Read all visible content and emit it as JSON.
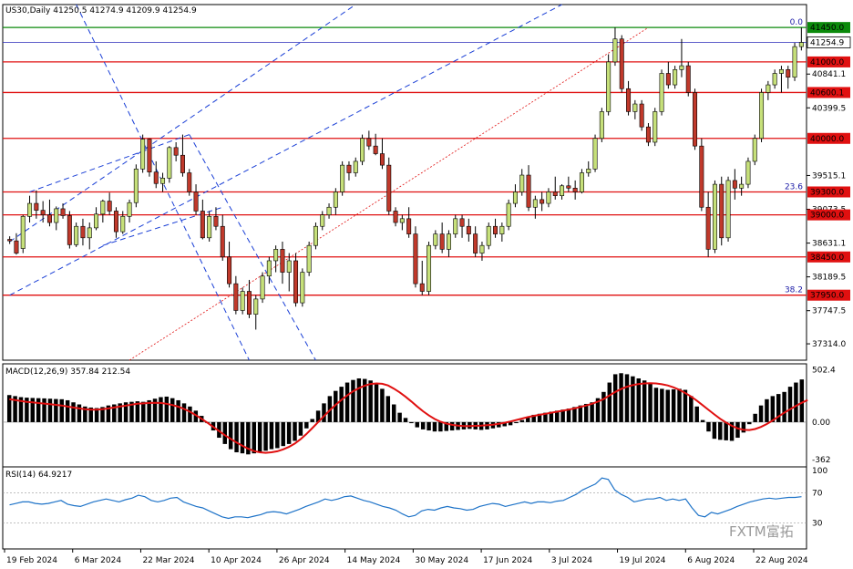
{
  "header": {
    "symbol_line": "US30,Daily  41250.5 41274.9 41209.9 41254.9",
    "macd_label": "MACD(12,26,9) 357.84 212.54",
    "rsi_label": "RSI(14) 64.9217"
  },
  "watermark": "FXTM富拓",
  "colors": {
    "bull": "#c6e07a",
    "bear": "#c0392b",
    "level": "#e01010",
    "channel": "#1a3fd6",
    "fib_line": "#0b8a0b",
    "rsi": "#1e73c8",
    "macd_signal": "#e01010",
    "grid": "#808080"
  },
  "chart_data": [
    {
      "type": "candlestick",
      "title": "US30,Daily",
      "ylim": [
        37100,
        41750
      ],
      "y_ticks": [
        41254.9,
        40841.1,
        40399.5,
        39515.1,
        39073.5,
        38631.1,
        38189.5,
        37747.5,
        37314.0
      ],
      "x_labels": [
        "19 Feb 2024",
        "6 Mar 2024",
        "22 Mar 2024",
        "10 Apr 2024",
        "26 Apr 2024",
        "14 May 2024",
        "30 May 2024",
        "17 Jun 2024",
        "3 Jul 2024",
        "19 Jul 2024",
        "6 Aug 2024",
        "22 Aug 2024"
      ],
      "horizontal_levels": [
        41450.0,
        41000.0,
        40600.1,
        40000.0,
        39300.0,
        39000.0,
        38450.0,
        37950.0
      ],
      "current_price": 41254.9,
      "fib_levels": [
        {
          "label": "0.0",
          "value": 41450.0
        },
        {
          "label": "23.6",
          "value": 39300.0
        },
        {
          "label": "38.2",
          "value": 37950.0
        }
      ],
      "candles": [
        [
          38680,
          38720,
          38620,
          38660
        ],
        [
          38660,
          38760,
          38480,
          38500
        ],
        [
          38560,
          39000,
          38500,
          38980
        ],
        [
          38980,
          39250,
          38900,
          39150
        ],
        [
          39150,
          39320,
          38950,
          39060
        ],
        [
          39060,
          39180,
          38900,
          39000
        ],
        [
          39000,
          39200,
          38850,
          38900
        ],
        [
          38900,
          39110,
          38800,
          39080
        ],
        [
          39080,
          39150,
          38950,
          38990
        ],
        [
          38990,
          39050,
          38560,
          38610
        ],
        [
          38610,
          38900,
          38580,
          38850
        ],
        [
          38850,
          38950,
          38600,
          38700
        ],
        [
          38700,
          38900,
          38550,
          38830
        ],
        [
          38830,
          39100,
          38800,
          39010
        ],
        [
          39010,
          39200,
          38900,
          39180
        ],
        [
          39180,
          39290,
          39000,
          39050
        ],
        [
          39050,
          39100,
          38700,
          38780
        ],
        [
          38780,
          39050,
          38750,
          38980
        ],
        [
          38980,
          39200,
          38900,
          39160
        ],
        [
          39160,
          39660,
          39100,
          39600
        ],
        [
          39600,
          40050,
          39550,
          39990
        ],
        [
          39990,
          40000,
          39500,
          39560
        ],
        [
          39560,
          39700,
          39350,
          39410
        ],
        [
          39410,
          39550,
          39300,
          39480
        ],
        [
          39480,
          39900,
          39420,
          39880
        ],
        [
          39880,
          39950,
          39700,
          39780
        ],
        [
          39780,
          40050,
          39500,
          39550
        ],
        [
          39550,
          39600,
          39250,
          39300
        ],
        [
          39300,
          39400,
          39000,
          39050
        ],
        [
          39050,
          39200,
          38680,
          38700
        ],
        [
          38700,
          39050,
          38650,
          38980
        ],
        [
          38980,
          39100,
          38800,
          38850
        ],
        [
          38850,
          39000,
          38400,
          38450
        ],
        [
          38450,
          38650,
          38050,
          38100
        ],
        [
          38100,
          38200,
          37700,
          37750
        ],
        [
          37750,
          38050,
          37700,
          38000
        ],
        [
          38000,
          38150,
          37650,
          37700
        ],
        [
          37700,
          37950,
          37500,
          37900
        ],
        [
          37900,
          38250,
          37850,
          38200
        ],
        [
          38200,
          38450,
          38100,
          38400
        ],
        [
          38400,
          38600,
          38250,
          38550
        ],
        [
          38550,
          38650,
          38100,
          38250
        ],
        [
          38250,
          38500,
          38000,
          38400
        ],
        [
          38400,
          38500,
          37800,
          37850
        ],
        [
          37850,
          38300,
          37800,
          38250
        ],
        [
          38250,
          38650,
          38200,
          38600
        ],
        [
          38600,
          38900,
          38550,
          38850
        ],
        [
          38850,
          39050,
          38800,
          39000
        ],
        [
          39000,
          39150,
          38950,
          39100
        ],
        [
          39100,
          39350,
          39000,
          39300
        ],
        [
          39300,
          39700,
          39250,
          39650
        ],
        [
          39650,
          39700,
          39450,
          39550
        ],
        [
          39550,
          39750,
          39500,
          39700
        ],
        [
          39700,
          40050,
          39650,
          40000
        ],
        [
          40000,
          40100,
          39850,
          39900
        ],
        [
          39900,
          40060,
          39780,
          39800
        ],
        [
          39800,
          40000,
          39600,
          39650
        ],
        [
          39650,
          39750,
          39000,
          39050
        ],
        [
          39050,
          39100,
          38850,
          38900
        ],
        [
          38900,
          39000,
          38800,
          38950
        ],
        [
          38950,
          39100,
          38700,
          38750
        ],
        [
          38750,
          38850,
          38050,
          38100
        ],
        [
          38100,
          38400,
          37950,
          38000
        ],
        [
          38000,
          38650,
          37950,
          38600
        ],
        [
          38600,
          38800,
          38550,
          38750
        ],
        [
          38750,
          38900,
          38500,
          38550
        ],
        [
          38550,
          38800,
          38450,
          38750
        ],
        [
          38750,
          39000,
          38700,
          38950
        ],
        [
          38950,
          39000,
          38700,
          38850
        ],
        [
          38850,
          38950,
          38650,
          38750
        ],
        [
          38750,
          38850,
          38450,
          38500
        ],
        [
          38500,
          38650,
          38400,
          38600
        ],
        [
          38600,
          38900,
          38550,
          38850
        ],
        [
          38850,
          38950,
          38700,
          38750
        ],
        [
          38750,
          38900,
          38650,
          38850
        ],
        [
          38850,
          39200,
          38800,
          39150
        ],
        [
          39150,
          39400,
          39100,
          39300
        ],
        [
          39300,
          39600,
          39250,
          39520
        ],
        [
          39520,
          39650,
          39050,
          39100
        ],
        [
          39100,
          39250,
          38950,
          39200
        ],
        [
          39200,
          39300,
          39050,
          39150
        ],
        [
          39150,
          39350,
          39100,
          39300
        ],
        [
          39300,
          39500,
          39200,
          39250
        ],
        [
          39250,
          39400,
          39200,
          39380
        ],
        [
          39380,
          39500,
          39300,
          39350
        ],
        [
          39350,
          39450,
          39200,
          39300
        ],
        [
          39300,
          39600,
          39280,
          39550
        ],
        [
          39550,
          39700,
          39500,
          39600
        ],
        [
          39600,
          40050,
          39560,
          40000
        ],
        [
          40000,
          40400,
          39950,
          40350
        ],
        [
          40350,
          41100,
          40300,
          41000
        ],
        [
          41000,
          41450,
          40950,
          41300
        ],
        [
          41300,
          41350,
          40600,
          40650
        ],
        [
          40650,
          40750,
          40300,
          40350
        ],
        [
          40350,
          40500,
          40250,
          40450
        ],
        [
          40450,
          40500,
          40100,
          40150
        ],
        [
          40150,
          40200,
          39900,
          39950
        ],
        [
          39950,
          40400,
          39900,
          40350
        ],
        [
          40350,
          40900,
          40300,
          40850
        ],
        [
          40850,
          41000,
          40650,
          40700
        ],
        [
          40700,
          40950,
          40650,
          40900
        ],
        [
          40900,
          41300,
          40800,
          40950
        ],
        [
          40950,
          41000,
          40550,
          40600
        ],
        [
          40600,
          40650,
          39850,
          39900
        ],
        [
          39900,
          40000,
          39050,
          39100
        ],
        [
          39100,
          39300,
          38450,
          38550
        ],
        [
          38550,
          39450,
          38500,
          39400
        ],
        [
          39400,
          39500,
          38600,
          38700
        ],
        [
          38700,
          39500,
          38650,
          39450
        ],
        [
          39450,
          39600,
          39200,
          39350
        ],
        [
          39350,
          39500,
          39250,
          39400
        ],
        [
          39400,
          39750,
          39350,
          39700
        ],
        [
          39700,
          40050,
          39650,
          40000
        ],
        [
          40000,
          40650,
          39950,
          40600
        ],
        [
          40600,
          40750,
          40500,
          40700
        ],
        [
          40700,
          40900,
          40650,
          40850
        ],
        [
          40850,
          40950,
          40600,
          40900
        ],
        [
          40900,
          40950,
          40650,
          40800
        ],
        [
          40800,
          41250,
          40750,
          41200
        ],
        [
          41200,
          41450,
          41150,
          41255
        ]
      ]
    },
    {
      "type": "bar",
      "title": "MACD(12,26,9) 357.84 212.54",
      "ylim": [
        -430,
        560
      ],
      "y_ticks": [
        502.4,
        0.0,
        -362
      ],
      "series": [
        {
          "name": "MACD",
          "values": [
            260,
            250,
            240,
            235,
            232,
            230,
            228,
            225,
            222,
            220,
            210,
            190,
            170,
            150,
            140,
            135,
            145,
            160,
            170,
            180,
            190,
            195,
            200,
            195,
            210,
            225,
            240,
            245,
            230,
            210,
            180,
            150,
            110,
            60,
            -10,
            -80,
            -150,
            -210,
            -260,
            -290,
            -300,
            -310,
            -300,
            -290,
            -275,
            -260,
            -250,
            -230,
            -210,
            -180,
            -130,
            -60,
            30,
            110,
            180,
            250,
            300,
            340,
            380,
            405,
            420,
            415,
            400,
            370,
            320,
            250,
            170,
            90,
            40,
            -10,
            -50,
            -70,
            -80,
            -90,
            -90,
            -85,
            -80,
            -75,
            -70,
            -65,
            -70,
            -75,
            -70,
            -60,
            -50,
            -40,
            -30,
            -10,
            20,
            50,
            70,
            80,
            90,
            100,
            110,
            120,
            130,
            145,
            160,
            175,
            190,
            230,
            290,
            380,
            460,
            470,
            460,
            440,
            420,
            400,
            370,
            330,
            320,
            310,
            315,
            320,
            310,
            250,
            150,
            20,
            -90,
            -160,
            -170,
            -175,
            -180,
            -150,
            -100,
            -20,
            80,
            160,
            220,
            250,
            270,
            290,
            340,
            380,
            410
          ]
        },
        {
          "name": "Signal",
          "values": [
            220,
            212,
            203,
            195,
            189,
            183,
            178,
            172,
            166,
            160,
            150,
            140,
            132,
            125,
            120,
            120,
            125,
            132,
            140,
            150,
            158,
            168,
            176,
            180,
            184,
            186,
            184,
            176,
            164,
            148,
            126,
            100,
            68,
            32,
            -6,
            -46,
            -86,
            -126,
            -162,
            -196,
            -228,
            -256,
            -278,
            -290,
            -295,
            -290,
            -280,
            -262,
            -238,
            -206,
            -164,
            -114,
            -58,
            0,
            58,
            114,
            166,
            214,
            258,
            296,
            326,
            350,
            366,
            372,
            368,
            352,
            322,
            286,
            244,
            198,
            150,
            104,
            64,
            30,
            4,
            -14,
            -26,
            -34,
            -38,
            -38,
            -36,
            -34,
            -30,
            -24,
            -16,
            -6,
            6,
            20,
            34,
            48,
            60,
            70,
            80,
            90,
            100,
            110,
            120,
            132,
            146,
            160,
            176,
            196,
            222,
            256,
            290,
            318,
            340,
            356,
            366,
            372,
            374,
            372,
            364,
            352,
            334,
            310,
            280,
            246,
            206,
            162,
            118,
            74,
            32,
            -4,
            -36,
            -60,
            -74,
            -76,
            -66,
            -46,
            -18,
            16,
            54,
            90,
            124,
            156,
            186,
            212
          ]
        }
      ]
    },
    {
      "type": "line",
      "title": "RSI(14) 64.9217",
      "ylim": [
        0,
        100
      ],
      "y_ticks": [
        100,
        70,
        30
      ],
      "series": [
        {
          "name": "RSI(14)",
          "values": [
            54,
            56,
            58,
            58,
            56,
            55,
            56,
            58,
            60,
            55,
            53,
            52,
            55,
            58,
            60,
            62,
            60,
            58,
            61,
            63,
            67,
            65,
            60,
            58,
            60,
            63,
            64,
            58,
            55,
            52,
            50,
            46,
            42,
            38,
            36,
            38,
            38,
            37,
            39,
            41,
            44,
            45,
            44,
            42,
            45,
            48,
            52,
            55,
            58,
            62,
            60,
            62,
            65,
            66,
            63,
            60,
            58,
            55,
            52,
            50,
            47,
            42,
            38,
            40,
            46,
            48,
            47,
            50,
            52,
            50,
            49,
            47,
            48,
            52,
            54,
            56,
            55,
            52,
            54,
            56,
            58,
            56,
            58,
            58,
            57,
            59,
            60,
            64,
            68,
            74,
            78,
            82,
            90,
            88,
            74,
            68,
            64,
            58,
            60,
            62,
            62,
            64,
            60,
            62,
            60,
            62,
            50,
            40,
            38,
            44,
            42,
            45,
            48,
            52,
            55,
            58,
            60,
            62,
            63,
            62,
            63,
            64,
            64,
            65
          ]
        }
      ]
    }
  ]
}
